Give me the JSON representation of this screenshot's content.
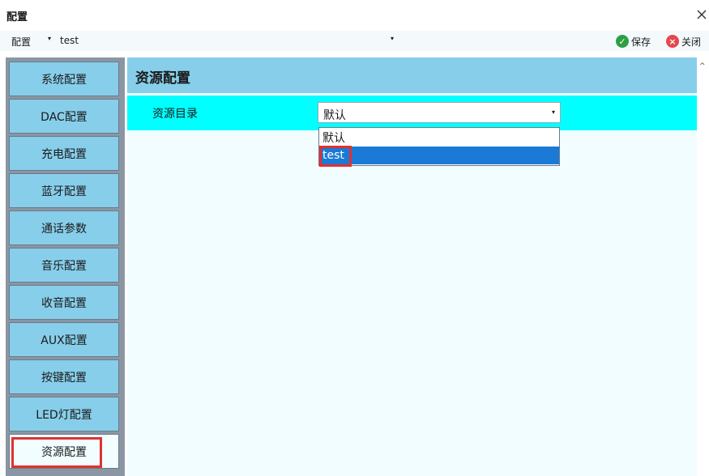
{
  "window": {
    "title": "配置",
    "close_glyph": "✕"
  },
  "toolbar": {
    "config_label": "配置",
    "config_value": "test",
    "dropdown_glyph": "▾",
    "save_label": "保存",
    "close_label": "关闭",
    "save_icon": "check-circle-icon",
    "close_icon": "x-circle-icon"
  },
  "sidebar": {
    "items": [
      {
        "label": "系统配置"
      },
      {
        "label": "DAC配置"
      },
      {
        "label": "充电配置"
      },
      {
        "label": "蓝牙配置"
      },
      {
        "label": "通话参数"
      },
      {
        "label": "音乐配置"
      },
      {
        "label": "收音配置"
      },
      {
        "label": "AUX配置"
      },
      {
        "label": "按键配置"
      },
      {
        "label": "LED灯配置"
      },
      {
        "label": "资源配置",
        "active": true
      }
    ]
  },
  "main": {
    "title": "资源配置",
    "resource_dir": {
      "label": "资源目录",
      "value": "默认",
      "options": [
        "默认",
        "test"
      ],
      "highlighted": "test"
    }
  },
  "colors": {
    "accent": "#87ceea",
    "row_highlight": "#00ffff",
    "selection": "#1a7ad6",
    "annotation": "#e03131",
    "panel_bg": "#f1fdff"
  }
}
